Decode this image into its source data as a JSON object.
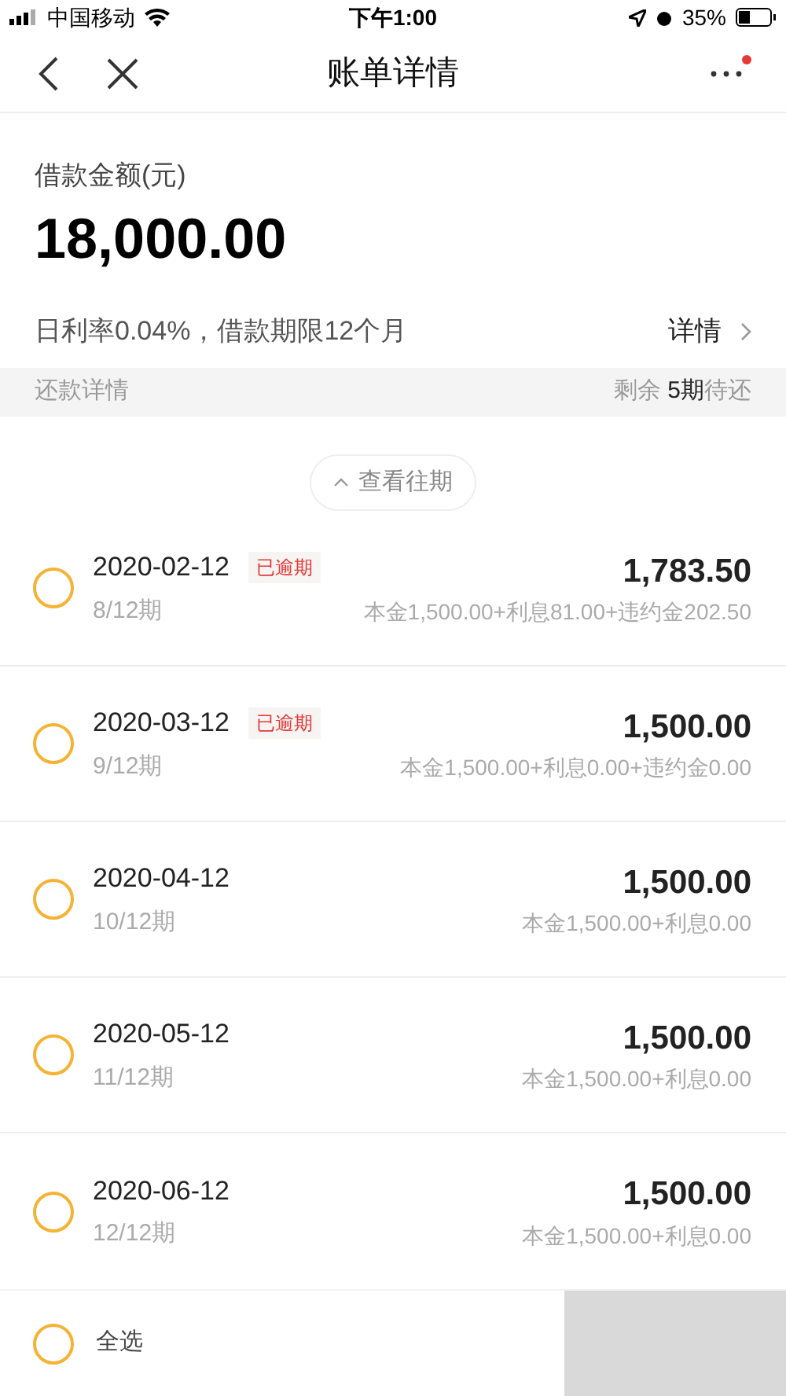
{
  "status_bar": {
    "carrier": "中国移动",
    "time": "下午1:00",
    "battery": "35%"
  },
  "nav": {
    "title": "账单详情",
    "has_notification": true
  },
  "loan": {
    "label": "借款金额(元)",
    "amount": "18,000.00",
    "terms": "日利率0.04%，借款期限12个月",
    "details_link": "详情"
  },
  "section": {
    "title": "还款详情",
    "remaining": "剩余 **5期**待还"
  },
  "view_past": "查看往期",
  "installments": [
    {
      "date": "2020-02-12",
      "tag": "已逾期",
      "period": "8/12期",
      "amount": "1,783.50",
      "breakdown": "本金1,500.00+利息81.00+违约金202.50",
      "checked": false
    },
    {
      "date": "2020-03-12",
      "tag": "已逾期",
      "period": "9/12期",
      "amount": "1,500.00",
      "breakdown": "本金1,500.00+利息0.00+违约金0.00",
      "checked": false
    },
    {
      "date": "2020-04-12",
      "period": "10/12期",
      "amount": "1,500.00",
      "breakdown": "本金1,500.00+利息0.00",
      "checked": false
    },
    {
      "date": "2020-05-12",
      "period": "11/12期",
      "amount": "1,500.00",
      "breakdown": "本金1,500.00+利息0.00",
      "checked": false
    },
    {
      "date": "2020-06-12",
      "period": "12/12期",
      "amount": "1,500.00",
      "breakdown": "本金1,500.00+利息0.00",
      "checked": false
    }
  ],
  "footer": {
    "select_all": "全选",
    "checked": false
  }
}
